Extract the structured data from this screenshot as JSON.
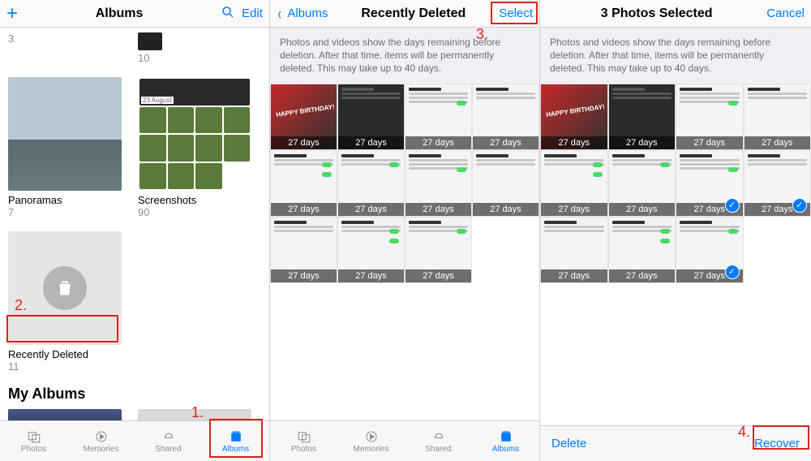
{
  "colors": {
    "accent": "#007aff",
    "callout": "#d8261c"
  },
  "pane1": {
    "nav": {
      "title": "Albums",
      "edit": "Edit"
    },
    "top": {
      "a": "3",
      "b": "10"
    },
    "albums": [
      {
        "name": "Panoramas",
        "count": "7"
      },
      {
        "name": "Screenshots",
        "count": "90",
        "date": "23 August"
      },
      {
        "name": "Recently Deleted",
        "count": "11"
      }
    ],
    "section": "My Albums",
    "tabs": {
      "photos": "Photos",
      "memories": "Memories",
      "shared": "Shared",
      "albums": "Albums"
    }
  },
  "pane2": {
    "nav": {
      "back": "Albums",
      "title": "Recently Deleted",
      "select": "Select"
    },
    "msg": "Photos and videos show the days remaining before deletion. After that time, items will be permanently deleted. This may take up to 40 days.",
    "days": "27 days",
    "tabs": {
      "photos": "Photos",
      "memories": "Memories",
      "shared": "Shared",
      "albums": "Albums"
    }
  },
  "pane3": {
    "nav": {
      "title": "3 Photos Selected",
      "cancel": "Cancel"
    },
    "msg": "Photos and videos show the days remaining before deletion. After that time, items will be permanently deleted. This may take up to 40 days.",
    "days": "27 days",
    "actions": {
      "delete": "Delete",
      "recover": "Recover"
    }
  },
  "callouts": {
    "n1": "1.",
    "n2": "2.",
    "n3": "3.",
    "n4": "4."
  }
}
